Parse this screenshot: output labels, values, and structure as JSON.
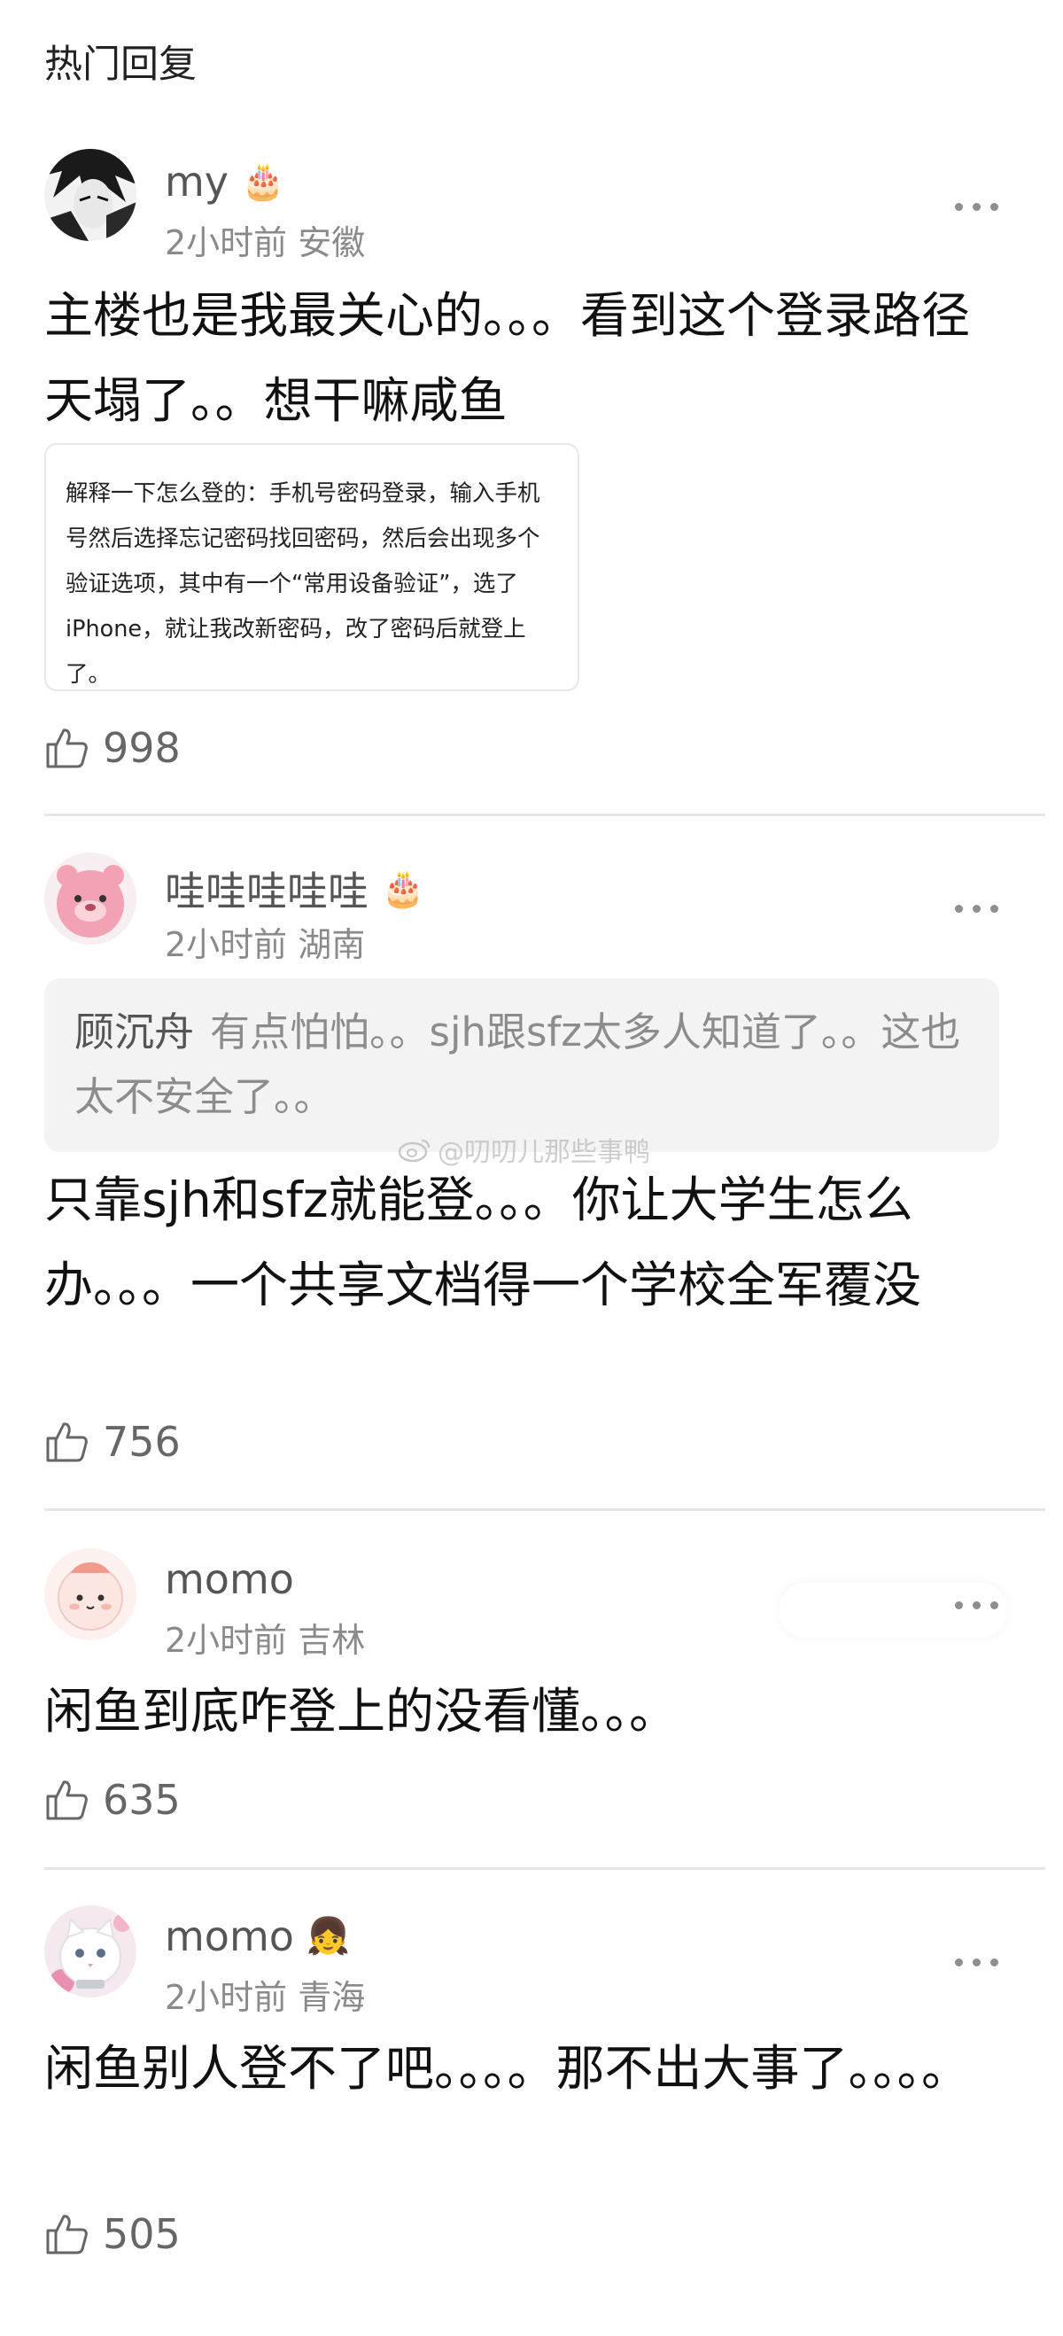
{
  "header": {
    "title": "热门回复"
  },
  "watermark": "@叨叨儿那些事鸭",
  "comments": [
    {
      "user": "my",
      "badge": "cake-icon",
      "time": "2小时前",
      "location": "安徽",
      "text": "主楼也是我最关心的。。。看到这个登录路径天塌了。。想干嘛咸鱼",
      "image_text": "解释一下怎么登的：手机号密码登录，输入手机号然后选择忘记密码找回密码，然后会出现多个验证选项，其中有一个“常用设备验证”，选了iPhone，就让我改新密码，改了密码后就登上了。",
      "likes": "998"
    },
    {
      "user": "哇哇哇哇哇",
      "badge": "cake-icon",
      "time": "2小时前",
      "location": "湖南",
      "quote_author": "顾沉舟",
      "quote_text": "有点怕怕。。sjh跟sfz太多人知道了。。这也太不安全了。。",
      "text": "只靠sjh和sfz就能登。。。你让大学生怎么办。。。一个共享文档得一个学校全军覆没",
      "likes": "756"
    },
    {
      "user": "momo",
      "time": "2小时前",
      "location": "吉林",
      "text": "闲鱼到底咋登上的没看懂。。。",
      "likes": "635"
    },
    {
      "user": "momo",
      "badge": "cartoon-girl-icon",
      "time": "2小时前",
      "location": "青海",
      "text": "闲鱼别人登不了吧。。。。那不出大事了。。。。",
      "likes": "505"
    }
  ],
  "colors": {
    "text": "#111111",
    "meta": "#8a8a8a",
    "quote_bg": "#f3f3f3",
    "divider": "#e6e6e6"
  }
}
